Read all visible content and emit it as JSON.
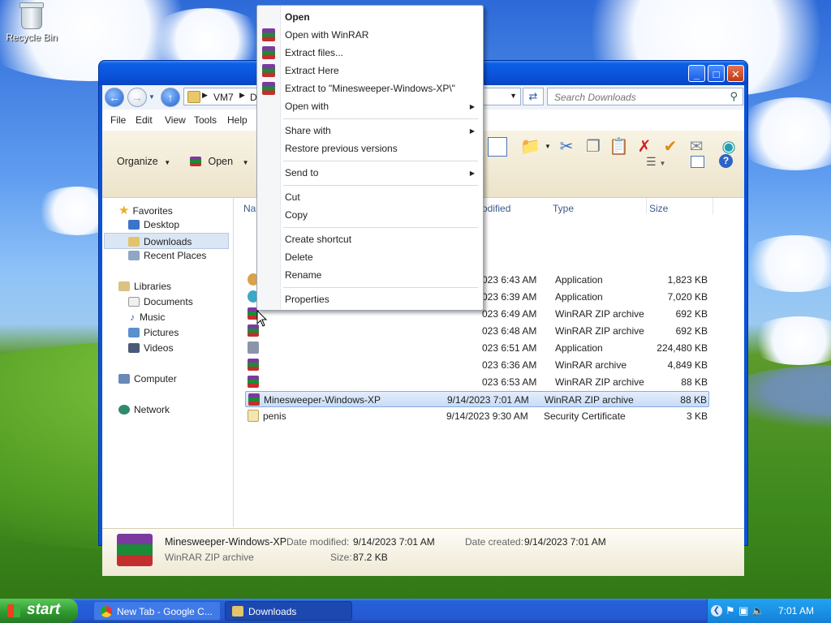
{
  "desktop": {
    "recycle_bin": "Recycle Bin"
  },
  "window": {
    "buttons": {
      "minimize": "_",
      "maximize": "□",
      "close": "✕"
    },
    "address": {
      "crumbs": [
        "VM7",
        "Do"
      ]
    },
    "search": {
      "placeholder": "Search Downloads"
    },
    "menu": [
      "File",
      "Edit",
      "View",
      "Tools",
      "Help"
    ],
    "command": {
      "organize": "Organize",
      "open": "Open"
    },
    "nav": {
      "favorites": "Favorites",
      "desktop": "Desktop",
      "downloads": "Downloads",
      "recent": "Recent Places",
      "libraries": "Libraries",
      "documents": "Documents",
      "music": "Music",
      "pictures": "Pictures",
      "videos": "Videos",
      "computer": "Computer",
      "network": "Network"
    },
    "columns": {
      "name": "Nan",
      "modified": "odified",
      "type": "Type",
      "size": "Size"
    },
    "files": [
      {
        "name": "",
        "date": "023 6:43 AM",
        "type": "Application",
        "size": "1,823 KB"
      },
      {
        "name": "",
        "date": "023 6:39 AM",
        "type": "Application",
        "size": "7,020 KB"
      },
      {
        "name": "",
        "date": "023 6:49 AM",
        "type": "WinRAR ZIP archive",
        "size": "692 KB"
      },
      {
        "name": "",
        "date": "023 6:48 AM",
        "type": "WinRAR ZIP archive",
        "size": "692 KB"
      },
      {
        "name": "",
        "date": "023 6:51 AM",
        "type": "Application",
        "size": "224,480 KB"
      },
      {
        "name": "",
        "date": "023 6:36 AM",
        "type": "WinRAR archive",
        "size": "4,849 KB"
      },
      {
        "name": "",
        "date": "023 6:53 AM",
        "type": "WinRAR ZIP archive",
        "size": "88 KB"
      },
      {
        "name": "Minesweeper-Windows-XP",
        "date": "9/14/2023 7:01 AM",
        "type": "WinRAR ZIP archive",
        "size": "88 KB"
      },
      {
        "name": "penis",
        "date": "9/14/2023 9:30 AM",
        "type": "Security Certificate",
        "size": "3 KB"
      }
    ],
    "details": {
      "name": "Minesweeper-Windows-XP",
      "type": "WinRAR ZIP archive",
      "modified_label": "Date modified:",
      "modified": "9/14/2023 7:01 AM",
      "created_label": "Date created:",
      "created": "9/14/2023 7:01 AM",
      "size_label": "Size:",
      "size": "87.2 KB"
    }
  },
  "context_menu": {
    "open": "Open",
    "open_winrar": "Open with WinRAR",
    "extract_files": "Extract files...",
    "extract_here": "Extract Here",
    "extract_to": "Extract to \"Minesweeper-Windows-XP\\\"",
    "open_with": "Open with",
    "share_with": "Share with",
    "restore": "Restore previous versions",
    "send_to": "Send to",
    "cut": "Cut",
    "copy": "Copy",
    "create_shortcut": "Create shortcut",
    "delete": "Delete",
    "rename": "Rename",
    "properties": "Properties"
  },
  "taskbar": {
    "start": "start",
    "tasks": [
      "New Tab - Google C...",
      "Downloads"
    ],
    "clock": "7:01 AM"
  }
}
